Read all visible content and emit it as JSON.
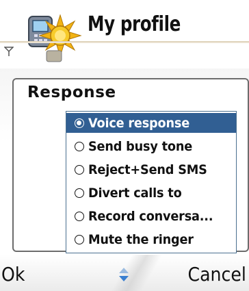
{
  "header": {
    "title": "My profile",
    "app_icon": "profile-sun-phone-icon",
    "signal_icon": "signal-antenna-icon"
  },
  "setting": {
    "label": "Response"
  },
  "options": [
    {
      "label": "Voice response",
      "selected": true
    },
    {
      "label": "Send busy tone",
      "selected": false
    },
    {
      "label": "Reject+Send SMS",
      "selected": false
    },
    {
      "label": "Divert calls to",
      "selected": false
    },
    {
      "label": "Record conversa...",
      "selected": false
    },
    {
      "label": "Mute the ringer",
      "selected": false
    }
  ],
  "softkeys": {
    "left": "Ok",
    "right": "Cancel",
    "nav_icon": "up-down-scroll-icon"
  },
  "colors": {
    "selection": "#315f93",
    "nav_arrows": "#3a7fd0",
    "panel_border": "#6c6c6c"
  }
}
